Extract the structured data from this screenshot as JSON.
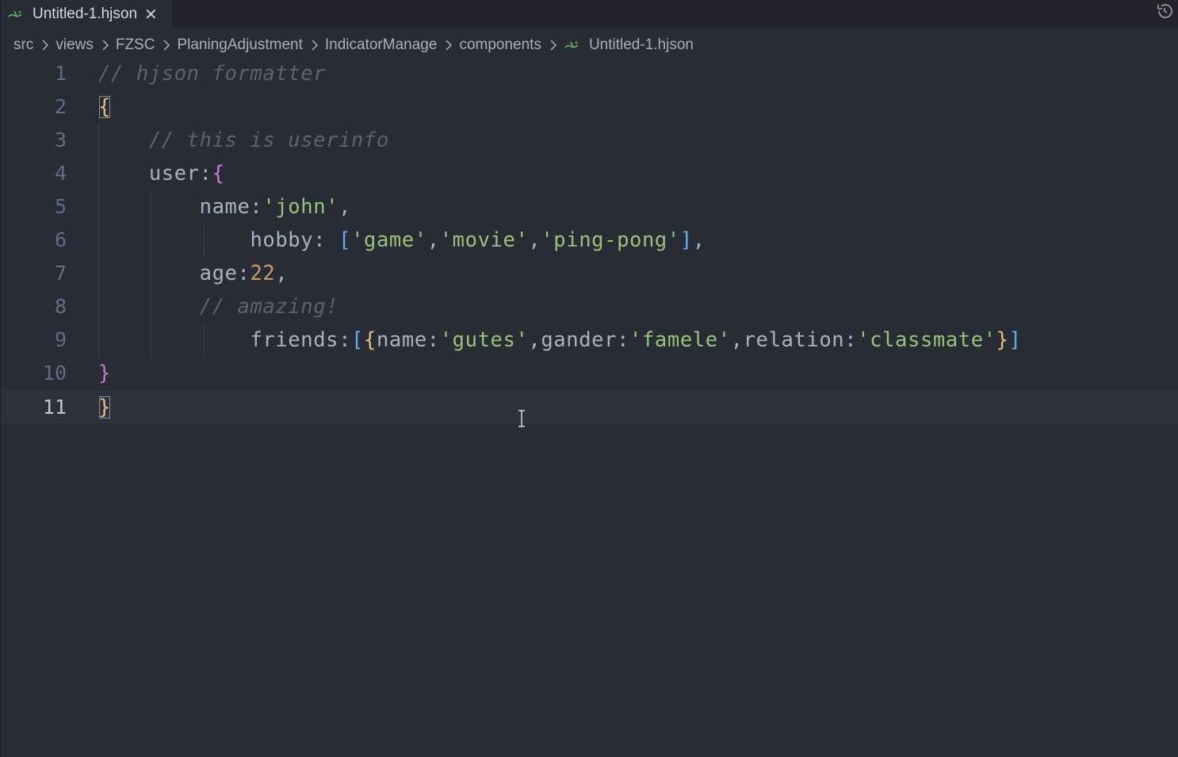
{
  "tab": {
    "label": "Untitled-1.hjson",
    "close": "✕",
    "icon": "hjson-file-icon"
  },
  "history_icon": "timeline-history-icon",
  "breadcrumb": {
    "items": [
      "src",
      "views",
      "FZSC",
      "PlaningAdjustment",
      "IndicatorManage",
      "components"
    ],
    "file": "Untitled-1.hjson"
  },
  "editor": {
    "current_line": 11,
    "line_numbers": [
      "1",
      "2",
      "3",
      "4",
      "5",
      "6",
      "7",
      "8",
      "9",
      "10",
      "11"
    ],
    "lines": {
      "l1": {
        "comment": "// hjson formatter"
      },
      "l2": {
        "brace": "{"
      },
      "l3": {
        "comment": "// this is userinfo"
      },
      "l4": {
        "key": "user:",
        "brace": "{"
      },
      "l5": {
        "key": "name:",
        "value": "'john'",
        "tail": ","
      },
      "l6": {
        "key": "hobby: ",
        "open": "[",
        "v1": "'game'",
        "c1": ",",
        "v2": "'movie'",
        "c2": ",",
        "v3": "'ping-pong'",
        "close": "]",
        "tail": ","
      },
      "l7": {
        "key": "age:",
        "value": "22",
        "tail": ","
      },
      "l8": {
        "comment": "// amazing!"
      },
      "l9": {
        "key": "friends:",
        "open_sq": "[",
        "open_br": "{",
        "k1": "name:",
        "v1": "'gutes'",
        "c1": ",",
        "k2": "gander:",
        "v2": "'famele'",
        "c2": ",",
        "k3": "relation:",
        "v3": "'classmate'",
        "close_br": "}",
        "close_sq": "]"
      },
      "l10": {
        "brace": "}"
      },
      "l11": {
        "brace": "}"
      }
    }
  },
  "colors": {
    "background": "#282c34",
    "comment": "#5c6370",
    "string": "#98c379",
    "number": "#d19a66",
    "bracket_gold": "#e6c07b",
    "bracket_purple": "#c678dd",
    "bracket_blue": "#61afef"
  }
}
